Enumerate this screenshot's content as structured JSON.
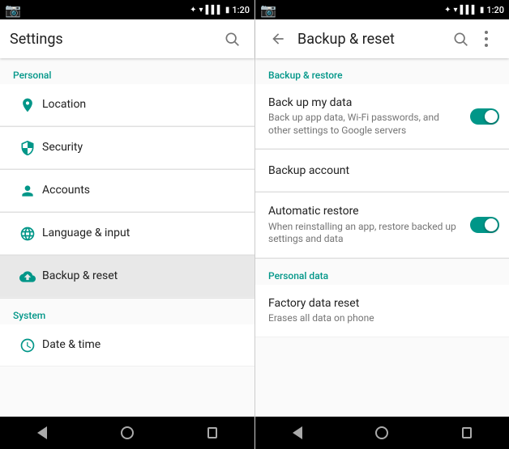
{
  "statusBar": {
    "time": "1:20",
    "icons": [
      "bt",
      "wifi",
      "signal",
      "battery"
    ]
  },
  "leftPanel": {
    "toolbar": {
      "title": "Settings",
      "searchLabel": "Search"
    },
    "sections": [
      {
        "label": "Personal",
        "items": [
          {
            "id": "location",
            "title": "Location",
            "icon": "location"
          },
          {
            "id": "security",
            "title": "Security",
            "icon": "security"
          },
          {
            "id": "accounts",
            "title": "Accounts",
            "icon": "accounts"
          },
          {
            "id": "language",
            "title": "Language & input",
            "icon": "language"
          },
          {
            "id": "backup",
            "title": "Backup & reset",
            "icon": "backup",
            "active": true
          }
        ]
      },
      {
        "label": "System",
        "items": [
          {
            "id": "datetime",
            "title": "Date & time",
            "icon": "datetime"
          }
        ]
      }
    ]
  },
  "rightPanel": {
    "toolbar": {
      "title": "Backup & reset",
      "searchLabel": "Search",
      "moreLabel": "More options"
    },
    "sections": [
      {
        "label": "Backup & restore",
        "items": [
          {
            "id": "backup-my-data",
            "title": "Back up my data",
            "subtitle": "Back up app data, Wi-Fi passwords, and other settings to Google servers",
            "toggle": true,
            "toggleOn": true
          },
          {
            "id": "backup-account",
            "title": "Backup account",
            "subtitle": "",
            "toggle": false,
            "toggleOn": false
          },
          {
            "id": "auto-restore",
            "title": "Automatic restore",
            "subtitle": "When reinstalling an app, restore backed up settings and data",
            "toggle": true,
            "toggleOn": true
          }
        ]
      },
      {
        "label": "Personal data",
        "items": [
          {
            "id": "factory-reset",
            "title": "Factory data reset",
            "subtitle": "Erases all data on phone",
            "toggle": false,
            "toggleOn": false
          }
        ]
      }
    ]
  }
}
